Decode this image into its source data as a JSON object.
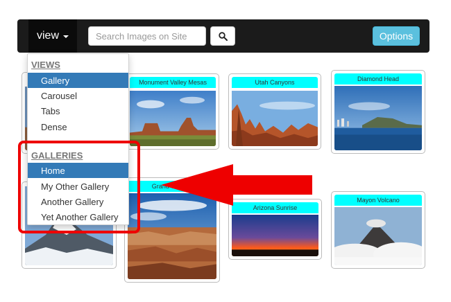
{
  "navbar": {
    "view_label": "view",
    "search_placeholder": "Search Images on Site",
    "options_label": "Options"
  },
  "dropdown": {
    "views_header": "VIEWS",
    "views": [
      "Gallery",
      "Carousel",
      "Tabs",
      "Dense"
    ],
    "active_view": "Gallery",
    "galleries_header": "GALLERIES",
    "galleries": [
      "Home",
      "My Other Gallery",
      "Another Gallery",
      "Yet Another Gallery"
    ],
    "active_gallery": "Home"
  },
  "gallery": {
    "cards": [
      {
        "title": "Monument Valley Mesas"
      },
      {
        "title": "Utah Canyons"
      },
      {
        "title": "Diamond Head"
      },
      {
        "title": "Grand Canyon"
      },
      {
        "title": "Arizona Sunrise"
      },
      {
        "title": "Mayon Volcano"
      }
    ]
  },
  "colors": {
    "navbar": "#1b1b1b",
    "card_title_bg": "#00ffff",
    "active_item": "#337ab7",
    "options_button": "#5bc0de",
    "annotation": "#ee0000"
  },
  "icons": {
    "search": "search-icon",
    "caret": "caret-down-icon",
    "arrow": "arrow-annotation"
  }
}
